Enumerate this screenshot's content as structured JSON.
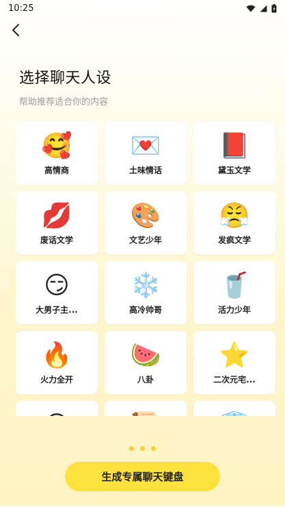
{
  "status_bar": {
    "time": "10:25",
    "icons": [
      "wifi-icon",
      "signal-icon",
      "battery-icon"
    ]
  },
  "header": {
    "back_icon": "chevron-left-icon",
    "title": "选择聊天人设",
    "subtitle": "帮助推荐适合你的内容"
  },
  "personas": [
    {
      "label": "高情商",
      "icon": "smiling-face-hearts-icon",
      "glyph": "🥰"
    },
    {
      "label": "土味情话",
      "icon": "heart-chat-bubble-icon",
      "glyph": "💌"
    },
    {
      "label": "黛玉文学",
      "icon": "red-book-icon",
      "glyph": "📕"
    },
    {
      "label": "废话文学",
      "icon": "lips-icon",
      "glyph": "💋"
    },
    {
      "label": "文艺少年",
      "icon": "paint-palette-icon",
      "glyph": "🎨"
    },
    {
      "label": "发疯文学",
      "icon": "angry-face-icon",
      "glyph": "😤"
    },
    {
      "label": "大男子主...",
      "icon": "smirking-face-icon",
      "glyph": "😏"
    },
    {
      "label": "高冷帅哥",
      "icon": "snowflake-icon",
      "glyph": "❄️"
    },
    {
      "label": "活力少年",
      "icon": "energy-can-icon",
      "glyph": "🥤"
    },
    {
      "label": "火力全开",
      "icon": "fire-icon",
      "glyph": "🔥"
    },
    {
      "label": "八卦",
      "icon": "watermelon-icon",
      "glyph": "🍉"
    },
    {
      "label": "二次元宅...",
      "icon": "purple-star-icon",
      "glyph": "⭐"
    },
    {
      "label": "",
      "icon": "partial-face-icon",
      "glyph": "😊"
    },
    {
      "label": "",
      "icon": "partial-item-icon",
      "glyph": "📜"
    },
    {
      "label": "",
      "icon": "partial-blue-icon",
      "glyph": "🧊"
    }
  ],
  "pagination": {
    "dot_color": "#f5d231",
    "dots": 3
  },
  "cta": {
    "label": "生成专属聊天键盘",
    "color": "#fde23e"
  },
  "colors": {
    "background_top": "#ffffff",
    "background_bottom": "#fff3c2",
    "card": "#ffffff",
    "subtitle": "#9a9a9a"
  }
}
